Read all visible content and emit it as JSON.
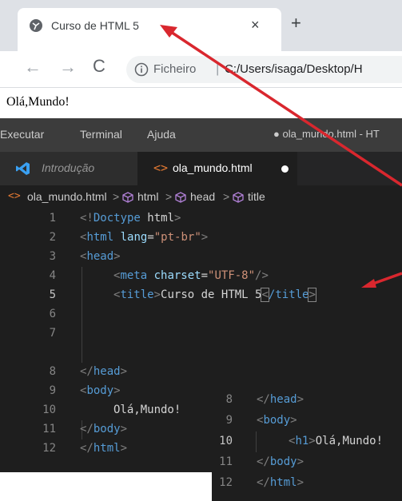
{
  "browser": {
    "tab_title": "Curso de HTML 5",
    "tab_close": "×",
    "new_tab": "+",
    "back": "←",
    "forward": "→",
    "reload": "C",
    "omnibox_label": "Ficheiro",
    "omnibox_sep": "|",
    "url": "C:/Users/isaga/Desktop/H"
  },
  "page": {
    "text": "Olá,Mundo!"
  },
  "vscode": {
    "menu": [
      "Executar",
      "Terminal",
      "Ajuda"
    ],
    "window_title": "● ola_mundo.html - HT",
    "tabs": [
      {
        "label": "Introdução"
      },
      {
        "label": "ola_mundo.html",
        "icon": "<>"
      }
    ],
    "breadcrumb": [
      "ola_mundo.html",
      "html",
      "head",
      "title"
    ],
    "breadcrumb_sep": ">",
    "line_numbers": [
      "1",
      "2",
      "3",
      "4",
      "5",
      "6",
      "7",
      "8",
      "9",
      "10",
      "11",
      "12"
    ],
    "code": {
      "l1": {
        "open": "<!",
        "tag": "Doctype",
        "attr": " html",
        "close": ">"
      },
      "l2": {
        "open": "<",
        "tag": "html",
        "attr": " lang",
        "eq": "=",
        "str": "\"pt-br\"",
        "close": ">"
      },
      "l3": {
        "open": "<",
        "tag": "head",
        "close": ">"
      },
      "l4": {
        "open": "<",
        "tag": "meta",
        "attr": " charset",
        "eq": "=",
        "str": "\"UTF-8\"",
        "close": "/>"
      },
      "l5": {
        "open": "<",
        "tag": "title",
        "close": ">",
        "text": "Curso de HTML 5",
        "open2": "<",
        "tag2": "/title",
        "close2": ">"
      },
      "l8": {
        "open": "</",
        "tag": "head",
        "close": ">"
      },
      "l9": {
        "open": "<",
        "tag": "body",
        "close": ">"
      },
      "l10": {
        "text": "Olá,Mundo!"
      },
      "l11": {
        "open": "</",
        "tag": "body",
        "close": ">"
      },
      "l12": {
        "open": "</",
        "tag": "html",
        "close": ">"
      }
    }
  },
  "overlay": {
    "line_numbers": [
      "8",
      "9",
      "10",
      "11",
      "12"
    ],
    "l8": {
      "open": "</",
      "tag": "head",
      "close": ">"
    },
    "l9": {
      "open": "<",
      "tag": "body",
      "close": ">"
    },
    "l10": {
      "open": "<",
      "tag": "h1",
      "close": ">",
      "text": "Olá,Mundo!"
    },
    "l11": {
      "open": "</",
      "tag": "body",
      "close": ">"
    },
    "l12": {
      "open": "</",
      "tag": "html",
      "close": ">"
    }
  },
  "colors": {
    "arrow": "#d9272e",
    "tag": "#569cd6",
    "attr": "#9cdcfe",
    "string": "#ce9178",
    "editor_bg": "#1e1e1e"
  }
}
